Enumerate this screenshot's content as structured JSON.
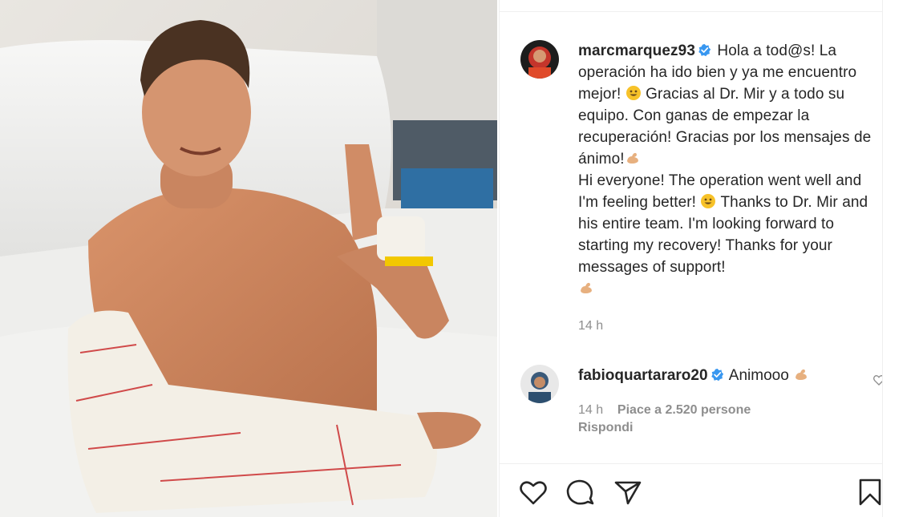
{
  "photo": {
    "alt_subject": "post-photo"
  },
  "post": {
    "author": "marcmarquez93",
    "caption_es": [
      {
        "text": "Hola a tod@s! La operación ha ido bien y ya me encuentro mejor! "
      },
      {
        "emoji": "smile"
      },
      {
        "text": " Gracias al Dr. Mir y a todo su equipo. Con ganas de empezar la recuperación! Gracias por los mensajes de ánimo!"
      },
      {
        "emoji": "flexed-biceps"
      }
    ],
    "caption_en": "Hi everyone! The operation went well and I'm feeling better! ",
    "caption_en_2": " Thanks to Dr. Mir and his entire team. I'm looking forward to starting my recovery! Thanks for your messages of support!",
    "time": "14 h"
  },
  "comment": {
    "author": "fabioquartararo20",
    "text": "Animooo ",
    "time": "14 h",
    "likes": "Piace a 2.520 persone",
    "reply": "Rispondi"
  },
  "icons": [
    "like-icon",
    "comment-icon",
    "share-icon",
    "save-icon",
    "verified-icon",
    "small-heart-icon"
  ],
  "colors": {
    "verified": "#3897f0",
    "text": "#262626",
    "meta": "#8e8e8e",
    "divider": "#efefef"
  }
}
